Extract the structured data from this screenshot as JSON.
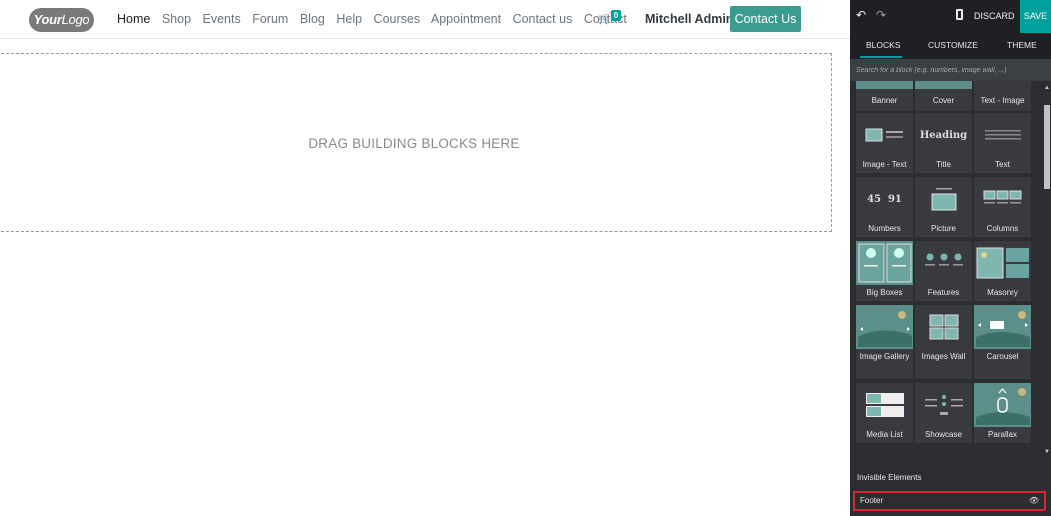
{
  "site": {
    "logo": {
      "text_bold": "Your",
      "text_light": "Logo"
    },
    "nav": [
      "Home",
      "Shop",
      "Events",
      "Forum",
      "Blog",
      "Help",
      "Courses",
      "Appointment",
      "Contact us",
      "Contact"
    ],
    "cart_count": "0",
    "user_name": "Mitchell Admin",
    "contact_button": "Contact Us",
    "dropzone_text": "DRAG BUILDING BLOCKS HERE"
  },
  "editor": {
    "discard": "DISCARD",
    "save": "SAVE",
    "tabs": {
      "blocks": "BLOCKS",
      "customize": "CUSTOMIZE",
      "theme": "THEME"
    },
    "search_placeholder": "Search for a block (e.g. numbers, image wall, ...)",
    "blocks": [
      {
        "label": "Banner"
      },
      {
        "label": "Cover"
      },
      {
        "label": "Text - Image"
      },
      {
        "label": "Image - Text"
      },
      {
        "label": "Title",
        "thumb_text": "Heading"
      },
      {
        "label": "Text"
      },
      {
        "label": "Numbers",
        "thumb_text": "45  91"
      },
      {
        "label": "Picture"
      },
      {
        "label": "Columns"
      },
      {
        "label": "Big Boxes"
      },
      {
        "label": "Features"
      },
      {
        "label": "Masonry"
      },
      {
        "label": "Image Gallery"
      },
      {
        "label": "Images Wall"
      },
      {
        "label": "Carousel"
      },
      {
        "label": "Media List"
      },
      {
        "label": "Showcase"
      },
      {
        "label": "Parallax"
      }
    ],
    "invisible_elements_title": "Invisible Elements",
    "invisible_elements": [
      {
        "label": "Footer"
      }
    ],
    "colors": {
      "accent": "#00a09d",
      "highlight": "#d82733",
      "panel_bg": "#2b2d31"
    }
  }
}
